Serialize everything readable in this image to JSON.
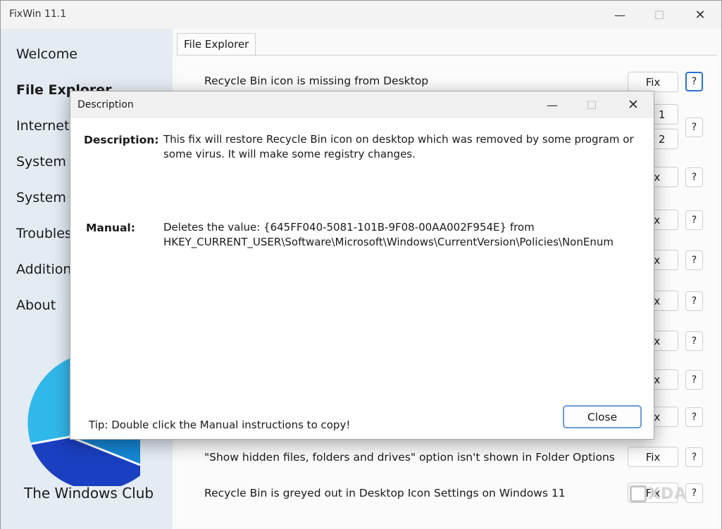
{
  "window": {
    "title": "FixWin 11.1"
  },
  "sidebar": {
    "items": [
      {
        "label": "Welcome",
        "active": false
      },
      {
        "label": "File Explorer",
        "active": true
      },
      {
        "label": "Internet & Connectivity",
        "active": false
      },
      {
        "label": "System Fixes",
        "active": false
      },
      {
        "label": "System Tools",
        "active": false
      },
      {
        "label": "Troubleshooters",
        "active": false
      },
      {
        "label": "Additional Fixes",
        "active": false
      },
      {
        "label": "About",
        "active": false
      }
    ],
    "brand": "The Windows Club"
  },
  "main": {
    "tab": "File Explorer",
    "rows": [
      {
        "label": "Recycle Bin icon is missing from Desktop",
        "button": "Fix"
      },
      {
        "label": "",
        "button": "Fix 1"
      },
      {
        "label": "",
        "button": "Fix 2"
      },
      {
        "label": "",
        "button": "Fix"
      },
      {
        "label": "",
        "button": "Fix"
      },
      {
        "label": "",
        "button": "Fix"
      },
      {
        "label": "",
        "button": "Fix"
      },
      {
        "label": "",
        "button": "Fix"
      },
      {
        "label": "",
        "button": "Fix"
      },
      {
        "label": "",
        "button": "Fix"
      },
      {
        "label": "\"Show hidden files, folders and drives\" option isn't shown in Folder Options",
        "button": "Fix"
      },
      {
        "label": "Recycle Bin is greyed out in Desktop Icon Settings on Windows 11",
        "button": "Fix"
      }
    ],
    "help_label": "?"
  },
  "dialog": {
    "title": "Description",
    "description_label": "Description:",
    "description_text": "This fix will restore Recycle Bin icon on desktop which was removed by some program or some virus. It will make some registry changes.",
    "manual_label": "Manual:",
    "manual_text_line1": "Deletes the value: {645FF040-5081-101B-9F08-00AA002F954E} from",
    "manual_text_line2": "HKEY_CURRENT_USER\\Software\\Microsoft\\Windows\\CurrentVersion\\Policies\\NonEnum",
    "tip": "Tip: Double click the Manual instructions to copy!",
    "close_label": "Close"
  },
  "watermark": {
    "text": "XDA"
  },
  "colors": {
    "accent": "#2a6fd6",
    "sidebar": "#e4ebf3",
    "logo_light": "#31b8ea",
    "logo_mid": "#1587d4",
    "logo_dark": "#1a3fc0"
  }
}
